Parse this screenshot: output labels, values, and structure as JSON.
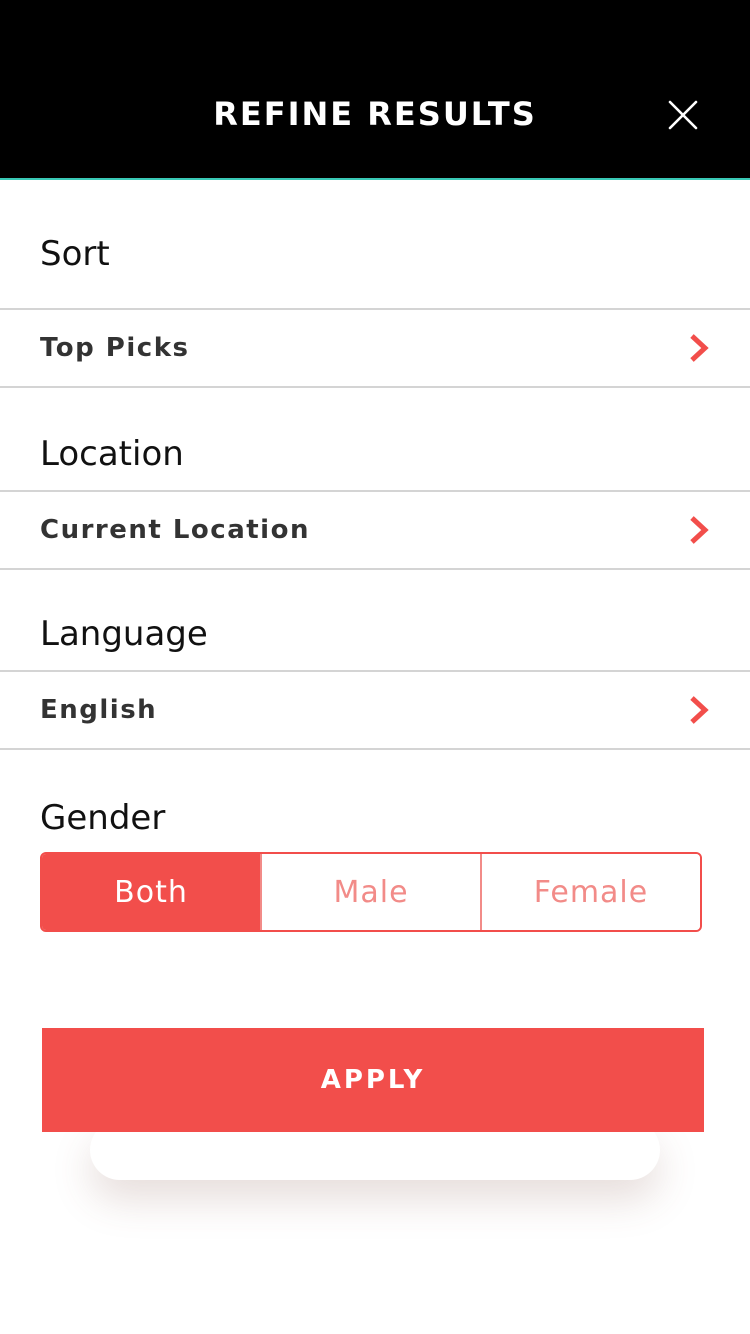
{
  "header": {
    "title": "REFINE RESULTS",
    "close_icon": "close-icon"
  },
  "sections": {
    "sort": {
      "label": "Sort",
      "value": "Top Picks",
      "icon": "chevron-right-icon"
    },
    "location": {
      "label": "Location",
      "value": "Current Location",
      "icon": "chevron-right-icon"
    },
    "language": {
      "label": "Language",
      "value": "English",
      "icon": "chevron-right-icon"
    },
    "gender": {
      "label": "Gender",
      "options": [
        "Both",
        "Male",
        "Female"
      ],
      "selected": "Both"
    }
  },
  "apply_button": {
    "label": "APPLY"
  },
  "colors": {
    "header_bg": "#000000",
    "header_accent_line": "#39c9b5",
    "accent": "#f24e4b",
    "accent_light": "#f28b88",
    "divider": "#d4d4d4"
  }
}
